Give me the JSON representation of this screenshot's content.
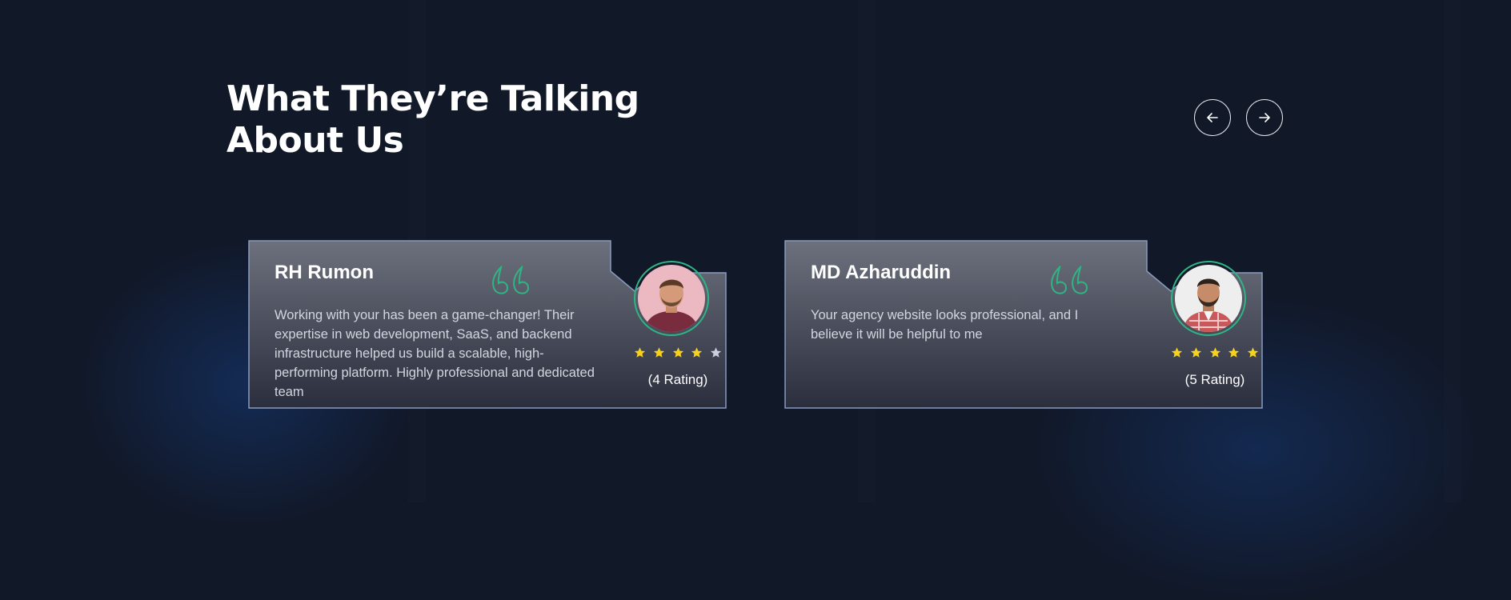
{
  "section": {
    "title_line1": "What They’re Talking",
    "title_line2": "About Us"
  },
  "nav": {
    "prev_icon": "arrow-left-icon",
    "next_icon": "arrow-right-icon"
  },
  "testimonials": [
    {
      "name": "RH Rumon",
      "text": "Working with your has been a game-changer! Their expertise in web development, SaaS, and backend infrastructure helped us build a scalable, high-performing platform. Highly professional and dedicated team",
      "rating": 4,
      "rating_max": 5,
      "rating_label": "(4 Rating)"
    },
    {
      "name": "MD Azharuddin",
      "text": "Your agency website looks professional, and I believe it will be helpful to me",
      "rating": 5,
      "rating_max": 5,
      "rating_label": "(5 Rating)"
    }
  ],
  "colors": {
    "background": "#111828",
    "accent_green": "#2fb583",
    "star_filled": "#f7d21c",
    "star_empty": "#c9cfe0"
  }
}
